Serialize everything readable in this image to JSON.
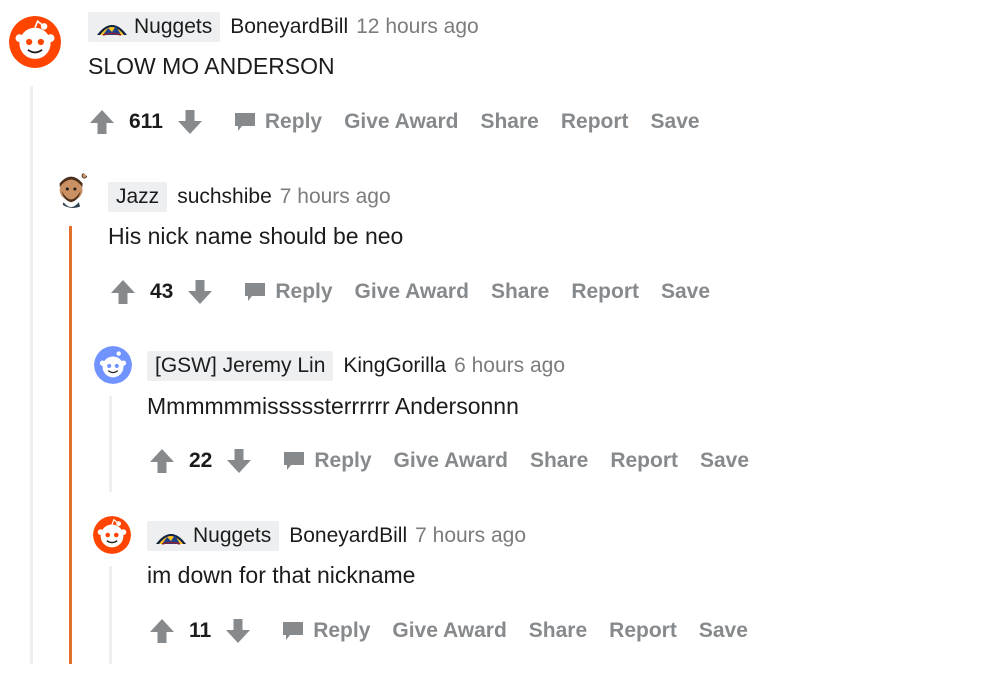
{
  "colors": {
    "accent_orange": "#ff4500",
    "thread_grey": "#edeff1",
    "thread_orange": "#e0702a",
    "meta_grey": "#878a8c"
  },
  "actions": {
    "reply": "Reply",
    "give_award": "Give Award",
    "share": "Share",
    "report": "Report",
    "save": "Save"
  },
  "comments": [
    {
      "flair": "Nuggets",
      "flair_icon": "nuggets-logo-icon",
      "avatar": "snoo-red-avatar",
      "username": "BoneyardBill",
      "time": "12 hours ago",
      "body": "SLOW MO ANDERSON",
      "score": "611"
    },
    {
      "flair": "Jazz",
      "avatar": "bearded-snoo-avatar",
      "username": "suchshibe",
      "time": "7 hours ago",
      "body": "His nick name should be neo",
      "score": "43"
    },
    {
      "flair": "[GSW] Jeremy Lin",
      "avatar": "snoo-blue-avatar",
      "username": "KingGorilla",
      "time": "6 hours ago",
      "body": "Mmmmmmisssssterrrrrr Andersonnn",
      "score": "22"
    },
    {
      "flair": "Nuggets",
      "flair_icon": "nuggets-logo-icon",
      "avatar": "snoo-red-avatar",
      "username": "BoneyardBill",
      "time": "7 hours ago",
      "body": "im down for that nickname",
      "score": "11"
    }
  ]
}
